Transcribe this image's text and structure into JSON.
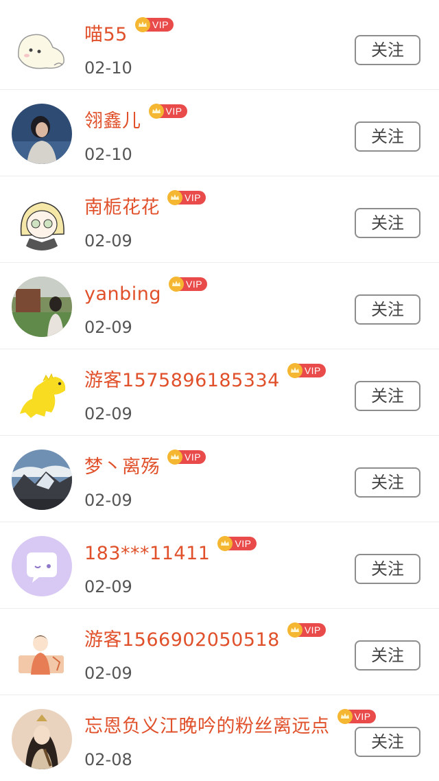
{
  "vip_label": "VIP",
  "follow_label": "关注",
  "colors": {
    "name": "#e0502a",
    "date": "#555555",
    "vip_badge": "#e94a4a",
    "crown": "#f5b731",
    "button_border": "#8d8d8d"
  },
  "items": [
    {
      "name": "喵55",
      "date": "02-10",
      "avatar": "cartoon-seal-avatar"
    },
    {
      "name": "翎鑫儿",
      "date": "02-10",
      "avatar": "woman-portrait-avatar"
    },
    {
      "name": "南栀花花",
      "date": "02-09",
      "avatar": "anime-girl-avatar"
    },
    {
      "name": "yanbing",
      "date": "02-09",
      "avatar": "outdoor-photo-avatar"
    },
    {
      "name": "游客1575896185334",
      "date": "02-09",
      "avatar": "yellow-dinosaur-avatar"
    },
    {
      "name": "梦丶离殇",
      "date": "02-09",
      "avatar": "mountain-landscape-avatar"
    },
    {
      "name": "183***11411",
      "date": "02-09",
      "avatar": "purple-chat-bubble-avatar"
    },
    {
      "name": "游客1566902050518",
      "date": "02-09",
      "avatar": "cartoon-boy-avatar"
    },
    {
      "name": "忘恩负义江晚吟的粉丝离远点",
      "date": "02-08",
      "avatar": "ancient-costume-avatar"
    }
  ]
}
